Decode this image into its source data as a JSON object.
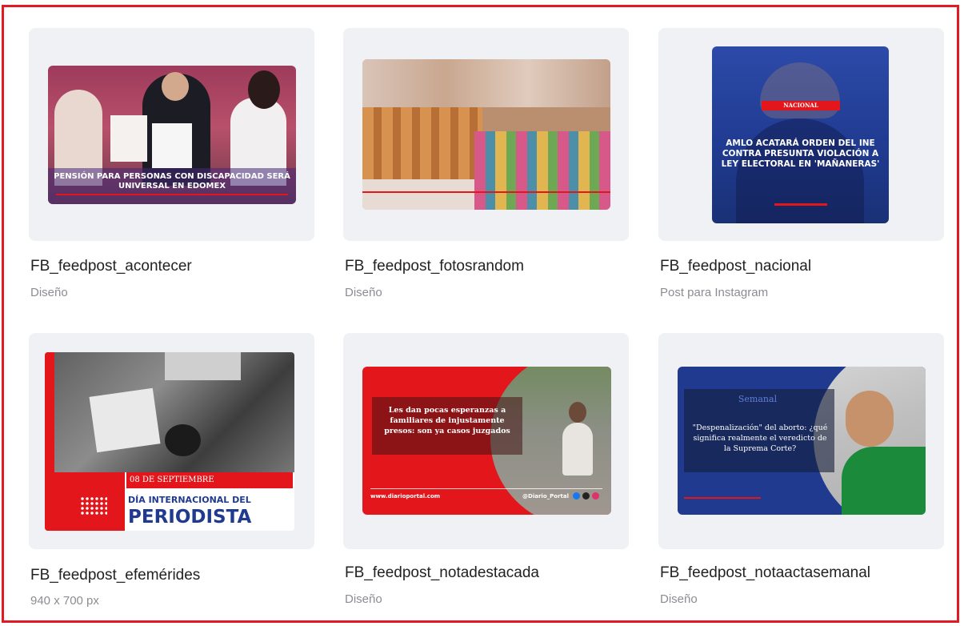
{
  "designs": [
    {
      "title": "FB_feedpost_acontecer",
      "subtitle": "Diseño",
      "caption": "PENSIÓN PARA PERSONAS CON DISCAPACIDAD SERÁ UNIVERSAL EN EDOMEX"
    },
    {
      "title": "FB_feedpost_fotosrandom",
      "subtitle": "Diseño"
    },
    {
      "title": "FB_feedpost_nacional",
      "subtitle": "Post para Instagram",
      "badge": "NACIONAL",
      "caption": "AMLO ACATARÁ ORDEN DEL INE CONTRA PRESUNTA VIOLACIÓN A LEY ELECTORAL EN 'MAÑANERAS'"
    },
    {
      "title": "FB_feedpost_efemérides",
      "subtitle": "940 x 700 px",
      "date": "08 DE SEPTIEMBRE",
      "line1": "DÍA INTERNACIONAL DEL",
      "line2": "PERIODISTA"
    },
    {
      "title": "FB_feedpost_notadestacada",
      "subtitle": "Diseño",
      "caption": "Les dan pocas esperanzas a familiares de injustamente presos: son ya casos juzgados",
      "site": "www.diarioportal.com",
      "handle": "@Diario_Portal"
    },
    {
      "title": "FB_feedpost_notaactasemanal",
      "subtitle": "Diseño",
      "badge": "Semanal",
      "caption": "\"Despenalización\" del aborto: ¿qué significa realmente el veredicto de la Suprema Corte?"
    }
  ],
  "colors": {
    "frame": "#e21a23",
    "card_bg": "#f0f1f4",
    "title": "#222222",
    "subtitle": "#8b8d93",
    "red": "#e3161b",
    "navy": "#1f3a8f"
  }
}
